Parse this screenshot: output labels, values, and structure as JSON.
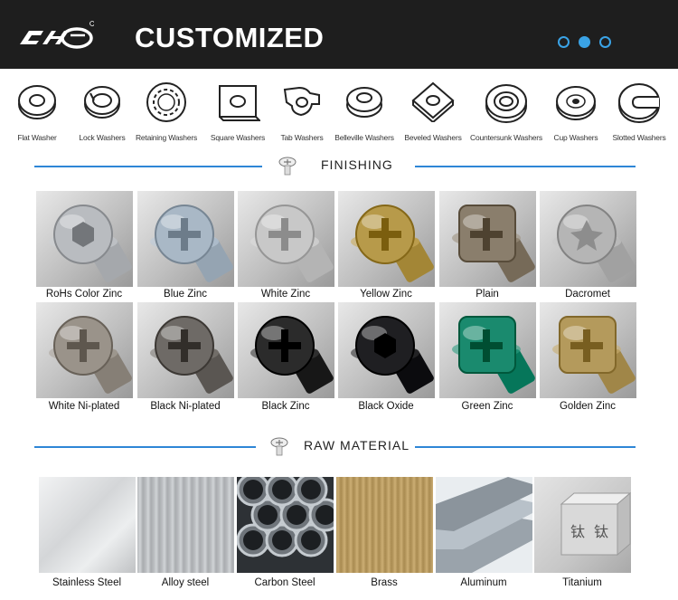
{
  "header": {
    "brand": "CHE",
    "title": "CUSTOMIZED",
    "carousel_dots": 3,
    "active_dot": 2,
    "accent": "#3aa3e6"
  },
  "washers": [
    {
      "label": "Flat Washer",
      "icon": "flat-washer-icon"
    },
    {
      "label": "Lock Washers",
      "icon": "lock-washer-icon"
    },
    {
      "label": "Retaining Washers",
      "icon": "retaining-washer-icon"
    },
    {
      "label": "Square Washers",
      "icon": "square-washer-icon"
    },
    {
      "label": "Tab Washers",
      "icon": "tab-washer-icon"
    },
    {
      "label": "Belleville Washers",
      "icon": "belleville-washer-icon"
    },
    {
      "label": "Beveled Washers",
      "icon": "beveled-washer-icon"
    },
    {
      "label": "Countersunk Washers",
      "icon": "countersunk-washer-icon"
    },
    {
      "label": "Cup Washers",
      "icon": "cup-washer-icon"
    },
    {
      "label": "Slotted Washers",
      "icon": "slotted-washer-icon"
    }
  ],
  "finishing": {
    "title": "FINISHING",
    "items": [
      {
        "label": "RoHs Color Zinc",
        "color": "#b9bcc0"
      },
      {
        "label": "Blue Zinc",
        "color": "#a9b8c6"
      },
      {
        "label": "White Zinc",
        "color": "#c8c8c8"
      },
      {
        "label": "Yellow Zinc",
        "color": "#b79a4a"
      },
      {
        "label": "Plain",
        "color": "#8a7e6c"
      },
      {
        "label": "Dacromet",
        "color": "#b5b5b5"
      },
      {
        "label": "White Ni-plated",
        "color": "#9a938a"
      },
      {
        "label": "Black Ni-plated",
        "color": "#6e6a66"
      },
      {
        "label": "Black Zinc",
        "color": "#2b2b2b"
      },
      {
        "label": "Black Oxide",
        "color": "#1f1f22"
      },
      {
        "label": "Green Zinc",
        "color": "#1a8a6e"
      },
      {
        "label": "Golden Zinc",
        "color": "#b49a5c"
      }
    ]
  },
  "raw_material": {
    "title": "RAW MATERIAL",
    "items": [
      {
        "label": "Stainless Steel",
        "color": "#d4d6d8"
      },
      {
        "label": "Alloy steel",
        "color": "#b8bbbe"
      },
      {
        "label": "Carbon Steel",
        "color": "#6f757b"
      },
      {
        "label": "Brass",
        "color": "#b89a60"
      },
      {
        "label": "Aluminum",
        "color": "#9aa3ab"
      },
      {
        "label": "Titanium",
        "color": "#c7c7c7"
      }
    ]
  }
}
